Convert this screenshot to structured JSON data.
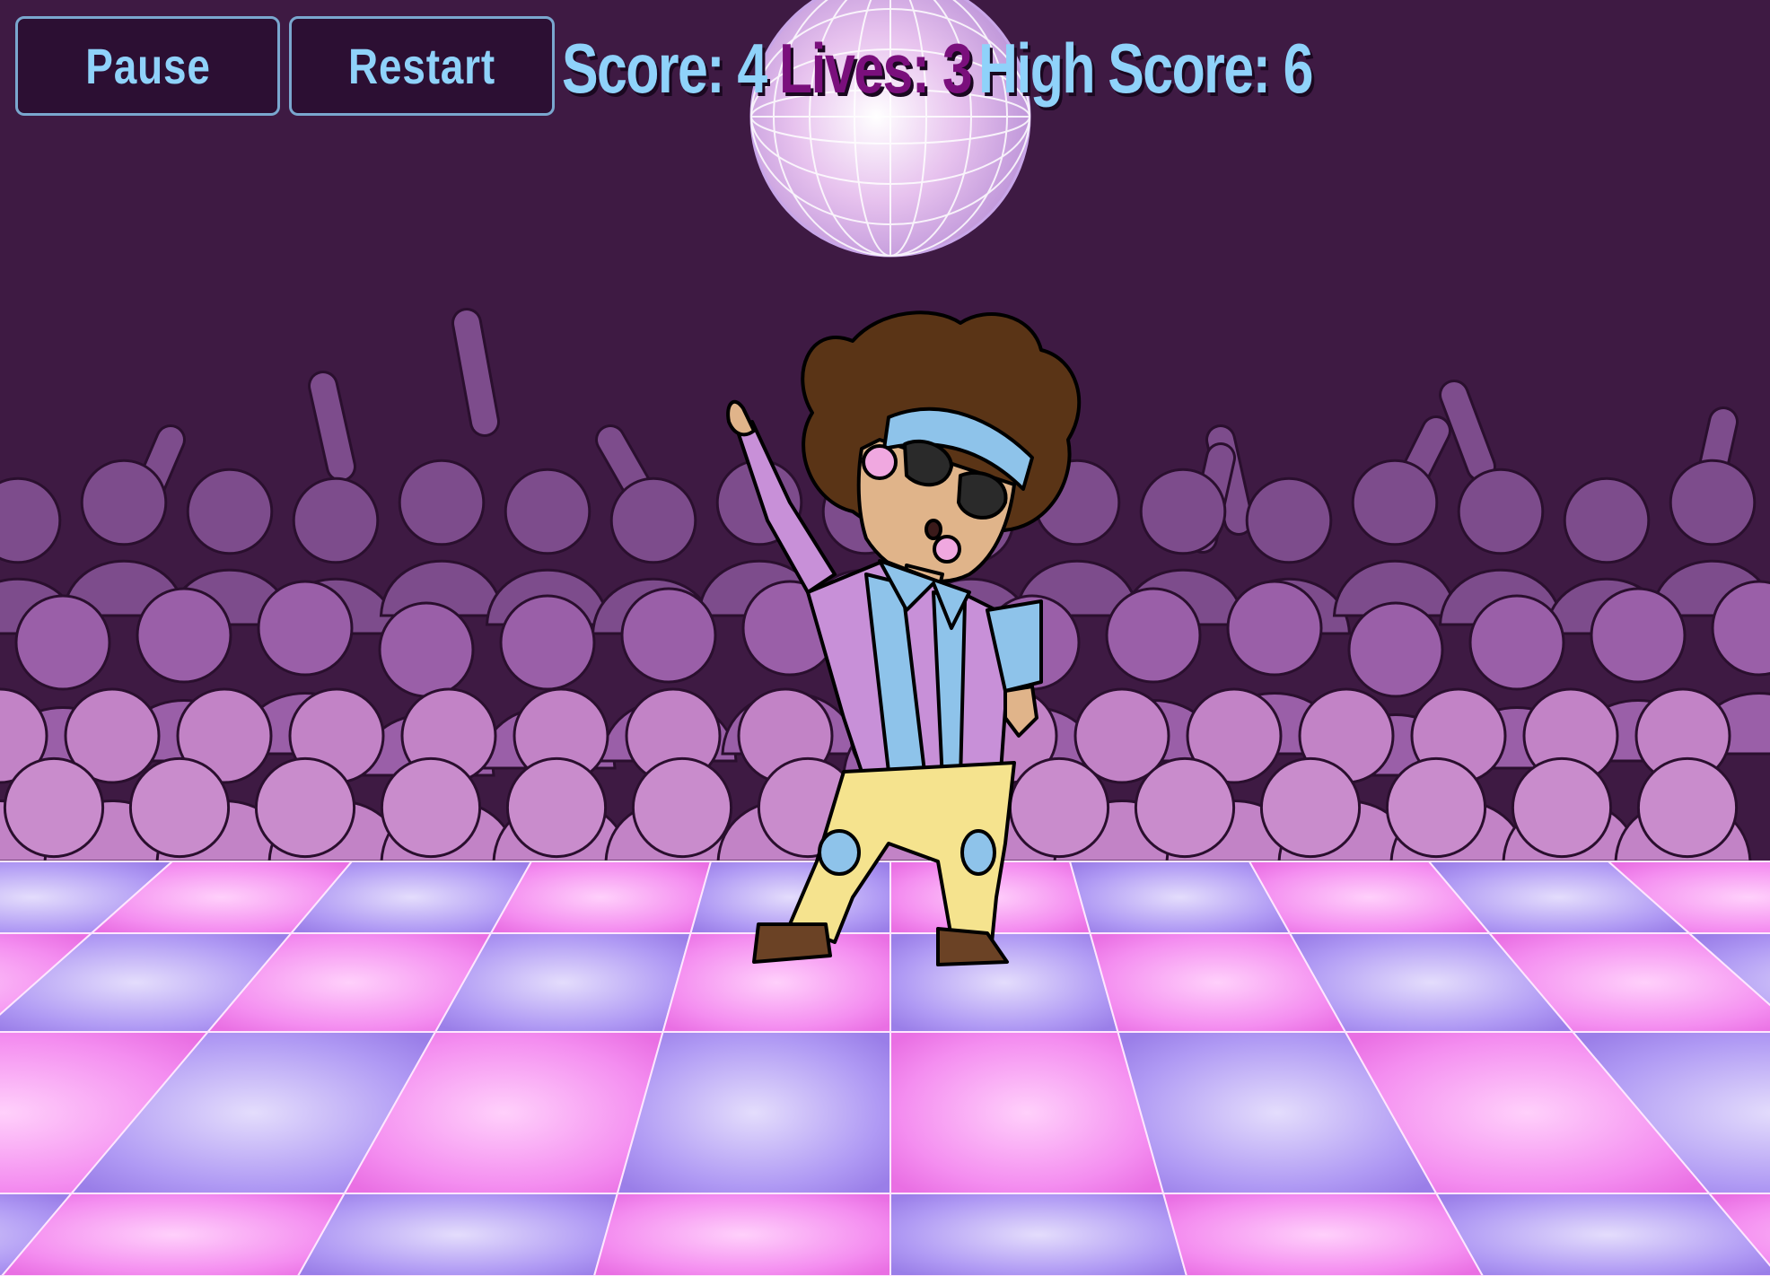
{
  "hud": {
    "pause_label": "Pause",
    "restart_label": "Restart",
    "score_label": "Score: 4",
    "lives_label": "Lives: 3",
    "high_score_label": "High Score: 6"
  },
  "game": {
    "score": 4,
    "lives": 3,
    "high_score": 6
  },
  "colors": {
    "background": "#3e1a43",
    "hud_text": "#8fd2fa",
    "lives_text": "#7a0f7c",
    "button_bg": "#2c0f33",
    "button_border": "#7aa7cf",
    "crowd_back": "#7a4a8a",
    "crowd_front": "#c67fc8",
    "tile_pink": "#f57fe8",
    "tile_lilac": "#a88af2"
  },
  "icons": {
    "disco_ball": "disco-ball-icon",
    "dancer": "disco-dancer-sprite"
  }
}
